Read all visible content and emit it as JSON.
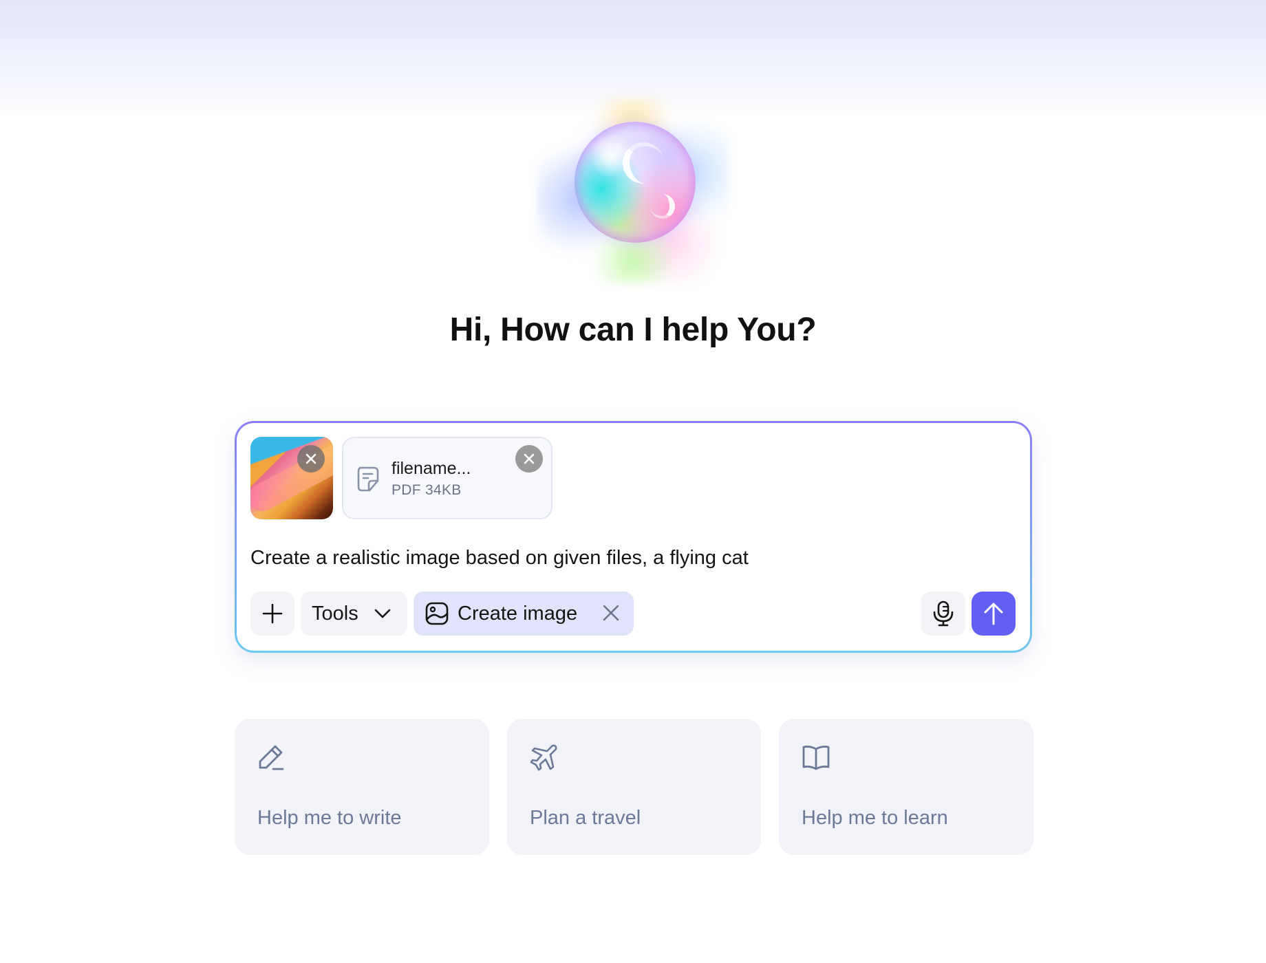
{
  "greeting": "Hi, How can I help You?",
  "attachments": {
    "image": {
      "remove_icon": "close-icon"
    },
    "file": {
      "name": "filename...",
      "meta": "PDF 34KB",
      "icon": "document-icon",
      "remove_icon": "close-icon"
    }
  },
  "composer": {
    "prompt": "Create a realistic image based on given files, a flying cat",
    "add_icon": "plus-icon",
    "tools_label": "Tools",
    "tools_icon": "chevron-down-icon",
    "create_image_label": "Create image",
    "create_image_icon": "image-icon",
    "mic_icon": "microphone-icon",
    "send_icon": "arrow-up-icon"
  },
  "suggestions": [
    {
      "label": "Help me to write",
      "icon": "pencil-icon"
    },
    {
      "label": "Plan a travel",
      "icon": "airplane-icon"
    },
    {
      "label": "Help me to learn",
      "icon": "book-icon"
    }
  ],
  "colors": {
    "accent": "#6160f2",
    "chip_bg": "#e1e3fb",
    "card_bg": "#f1f3f8",
    "card_text": "#6b7898"
  }
}
